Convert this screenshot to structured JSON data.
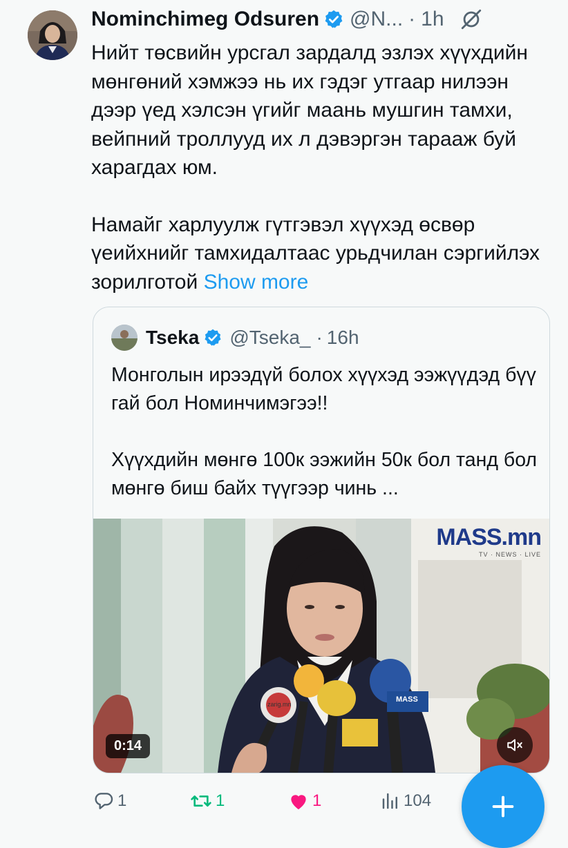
{
  "tweet": {
    "author_name": "Nominchimeg Odsuren",
    "handle": "@N...",
    "separator": "·",
    "time": "1h",
    "paragraphs": [
      "Нийт төсвийн урсгал зардалд эзлэх хүүхдийн мөнгөний хэмжээ нь их гэдэг утгаар нилээн дээр үед хэлсэн үгийг маань мушгин тамхи, вейпний троллууд их л дэвэргэн тарааж буй харагдах юм.",
      "Намайг харлуулж гүтгэвэл хүүхэд өсвөр үеийхнийг тамхидалтаас урьдчилан сэргийлэх зорилготой"
    ],
    "show_more": "Show more",
    "colors": {
      "accent": "#1d9bf0",
      "like": "#f91880",
      "retweet": "#00ba7c"
    }
  },
  "quote": {
    "author_name": "Tseka",
    "handle": "@Tseka_",
    "separator": "·",
    "time": "16h",
    "paragraphs": [
      "Монголын ирээдүй болох хүүхэд ээжүүдэд бүү гай бол Номинчимэгээ!!",
      "Хүүхдийн мөнгө 100к ээжийн 50к бол танд бол мөнгө биш байх түүгээр чинь ..."
    ],
    "video": {
      "duration": "0:14",
      "watermark": "MASS.mn",
      "watermark_sub": "TV · NEWS · LIVE",
      "mic_labels": [
        "zarig.mn",
        "MASS"
      ]
    }
  },
  "actions": {
    "replies": "1",
    "retweets": "1",
    "likes": "1",
    "views": "104"
  },
  "icons": {
    "verified": "verified-badge-icon",
    "grok": "grok-icon",
    "reply": "reply-icon",
    "retweet": "retweet-icon",
    "like": "heart-icon",
    "views": "views-chart-icon",
    "mute": "mute-icon",
    "compose": "plus-icon"
  }
}
